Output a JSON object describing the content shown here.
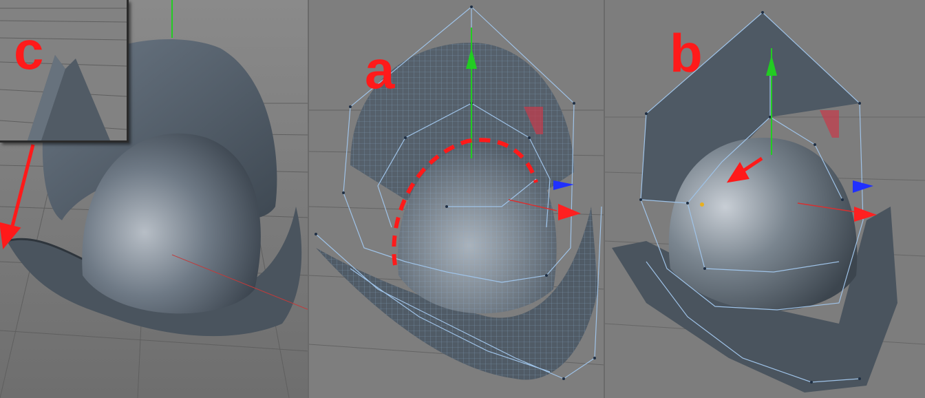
{
  "labels": {
    "a": "a",
    "b": "b",
    "c": "c"
  },
  "colors": {
    "viewport_bg": "#7c7c7c",
    "mesh_shade": "#4e5a66",
    "wire": "#9fc3e8",
    "axis_y": "#22cc22",
    "axis_x": "#ff2020",
    "axis_z": "#2030ff",
    "annotation": "#ff1a1a"
  },
  "panels": [
    "smooth-render",
    "subdivision-wireframe",
    "cage-polygons"
  ]
}
